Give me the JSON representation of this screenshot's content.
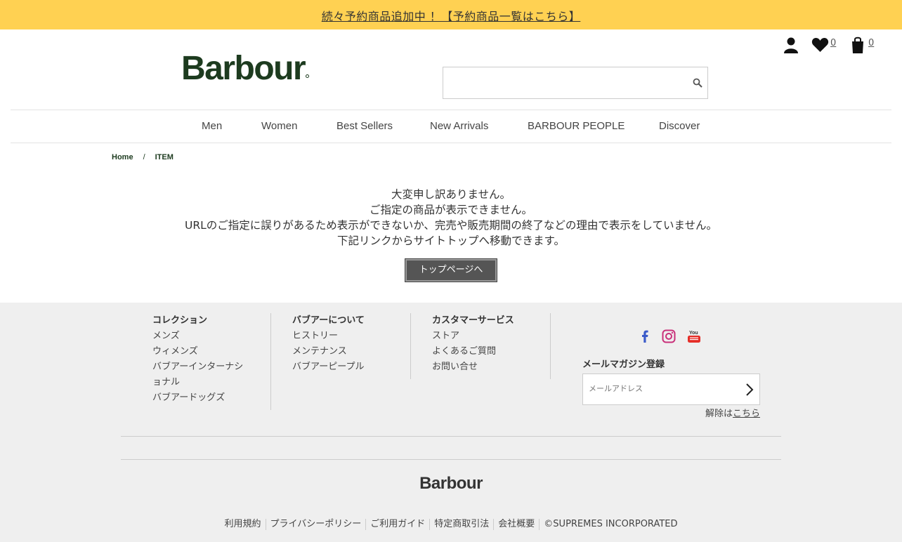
{
  "banner": {
    "text": "続々予約商品追加中 ！【予約商品一覧はこちら】"
  },
  "header": {
    "logo": "Barbour",
    "search": {
      "placeholder": ""
    },
    "wishlist_count": "0",
    "cart_count": "0"
  },
  "nav": {
    "items": [
      "Men",
      "Women",
      "Best Sellers",
      "New Arrivals",
      "BARBOUR PEOPLE",
      "Discover"
    ]
  },
  "breadcrumb": {
    "home": "Home",
    "separator": "/",
    "current": "ITEM"
  },
  "message": {
    "lines": [
      "大変申し訳ありません。",
      "ご指定の商品が表示できません。",
      "URLのご指定に誤りがあるため表示ができないか、完売や販売期間の終了などの理由で表示をしていません。",
      "下記リンクからサイトトップへ移動できます。"
    ],
    "button": "トップページへ"
  },
  "footer": {
    "columns": [
      {
        "title": "コレクション",
        "links": [
          "メンズ",
          "ウィメンズ",
          "バブアーインターナショナル",
          "バブアードッグズ"
        ]
      },
      {
        "title": "バブアーについて",
        "links": [
          "ヒストリー",
          "メンテナンス",
          "バブアーピープル"
        ]
      },
      {
        "title": "カスタマーサービス",
        "links": [
          "ストア",
          "よくあるご質問",
          "お問い合せ"
        ]
      }
    ],
    "social_icons": [
      "facebook-icon",
      "instagram-icon",
      "youtube-icon"
    ],
    "youtube_label": "You",
    "newsletter": {
      "title": "メールマガジン登録",
      "placeholder": "メールアドレス",
      "unsubscribe_prefix": "解除は",
      "unsubscribe_link": "こちら"
    },
    "logo": "Barbour",
    "legal": [
      "利用規約",
      "プライバシーポリシー",
      "ご利用ガイド",
      "特定商取引法",
      "会社概要",
      "©SUPREMES INCORPORATED"
    ]
  },
  "colors": {
    "banner": "#ffd152",
    "brand_green": "#1d3b1f",
    "footer_bg": "#efefef",
    "button_bg": "#555555"
  }
}
